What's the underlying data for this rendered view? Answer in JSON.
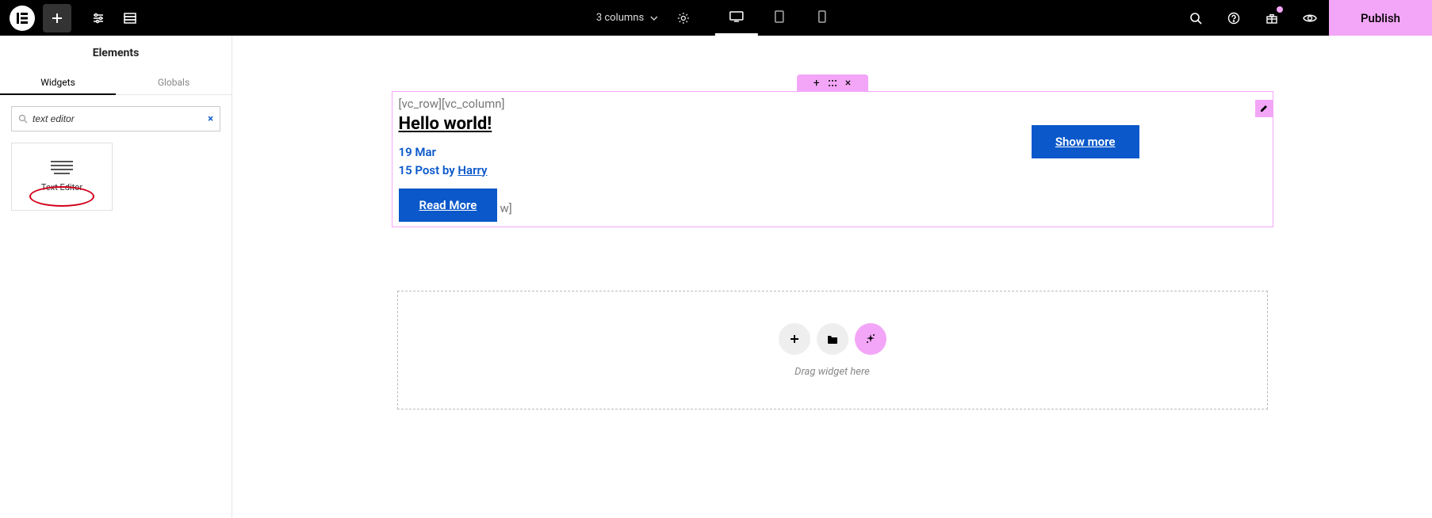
{
  "topbar": {
    "structure_label": "3 columns",
    "publish_label": "Publish"
  },
  "sidebar": {
    "title": "Elements",
    "tabs": {
      "widgets": "Widgets",
      "globals": "Globals"
    },
    "search": {
      "value": "text editor"
    },
    "widget": {
      "label": "Text Editor"
    }
  },
  "canvas": {
    "shortcode_open": "[vc_row][vc_column]",
    "shortcode_trail": "w]",
    "post_title": "Hello world!",
    "post_date": "19 Mar",
    "post_meta_prefix": "15 Post by ",
    "post_author": "Harry",
    "read_more": "Read More",
    "show_more": "Show more",
    "drag_hint": "Drag widget here"
  }
}
